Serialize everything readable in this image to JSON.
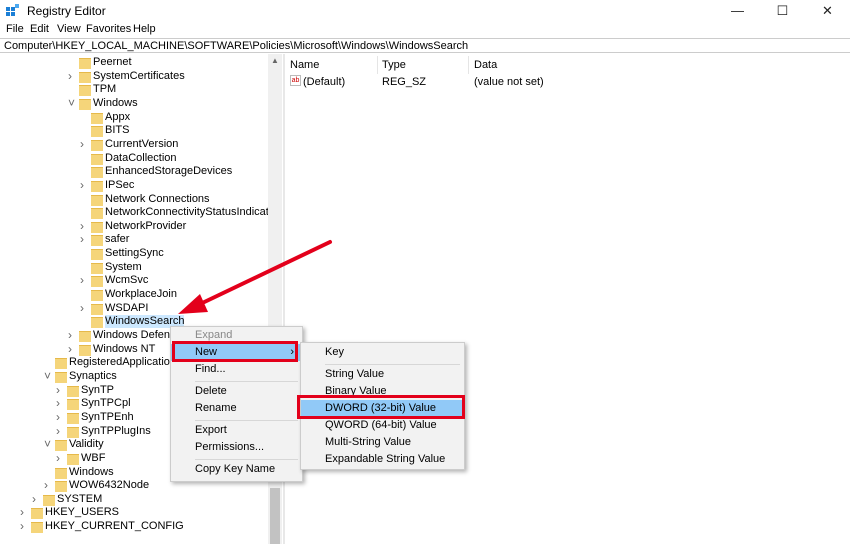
{
  "window": {
    "title": "Registry Editor",
    "controls": [
      "minimize",
      "maximize",
      "close"
    ]
  },
  "menubar": [
    "File",
    "Edit",
    "View",
    "Favorites",
    "Help"
  ],
  "address": "Computer\\HKEY_LOCAL_MACHINE\\SOFTWARE\\Policies\\Microsoft\\Windows\\WindowsSearch",
  "tree": [
    {
      "label": "Peernet",
      "level": 4,
      "exp": ""
    },
    {
      "label": "SystemCertificates",
      "level": 4,
      "exp": ">"
    },
    {
      "label": "TPM",
      "level": 4,
      "exp": ""
    },
    {
      "label": "Windows",
      "level": 4,
      "exp": "v"
    },
    {
      "label": "Appx",
      "level": 5,
      "exp": ""
    },
    {
      "label": "BITS",
      "level": 5,
      "exp": ""
    },
    {
      "label": "CurrentVersion",
      "level": 5,
      "exp": ">"
    },
    {
      "label": "DataCollection",
      "level": 5,
      "exp": ""
    },
    {
      "label": "EnhancedStorageDevices",
      "level": 5,
      "exp": ""
    },
    {
      "label": "IPSec",
      "level": 5,
      "exp": ">"
    },
    {
      "label": "Network Connections",
      "level": 5,
      "exp": ""
    },
    {
      "label": "NetworkConnectivityStatusIndicator",
      "level": 5,
      "exp": ""
    },
    {
      "label": "NetworkProvider",
      "level": 5,
      "exp": ">"
    },
    {
      "label": "safer",
      "level": 5,
      "exp": ">"
    },
    {
      "label": "SettingSync",
      "level": 5,
      "exp": ""
    },
    {
      "label": "System",
      "level": 5,
      "exp": ""
    },
    {
      "label": "WcmSvc",
      "level": 5,
      "exp": ">"
    },
    {
      "label": "WorkplaceJoin",
      "level": 5,
      "exp": ""
    },
    {
      "label": "WSDAPI",
      "level": 5,
      "exp": ">"
    },
    {
      "label": "WindowsSearch",
      "level": 5,
      "exp": "",
      "selected": true
    },
    {
      "label": "Windows Defender",
      "level": 4,
      "exp": ">"
    },
    {
      "label": "Windows NT",
      "level": 4,
      "exp": ">"
    },
    {
      "label": "RegisteredApplications",
      "level": 2,
      "exp": ""
    },
    {
      "label": "Synaptics",
      "level": 2,
      "exp": "v"
    },
    {
      "label": "SynTP",
      "level": 3,
      "exp": ">"
    },
    {
      "label": "SynTPCpl",
      "level": 3,
      "exp": ">"
    },
    {
      "label": "SynTPEnh",
      "level": 3,
      "exp": ">"
    },
    {
      "label": "SynTPPlugIns",
      "level": 3,
      "exp": ">"
    },
    {
      "label": "Validity",
      "level": 2,
      "exp": "v"
    },
    {
      "label": "WBF",
      "level": 3,
      "exp": ">"
    },
    {
      "label": "Windows",
      "level": 2,
      "exp": ""
    },
    {
      "label": "WOW6432Node",
      "level": 2,
      "exp": ">"
    },
    {
      "label": "SYSTEM",
      "level": 1,
      "exp": ">"
    },
    {
      "label": "HKEY_USERS",
      "level": 0,
      "exp": ">"
    },
    {
      "label": "HKEY_CURRENT_CONFIG",
      "level": 0,
      "exp": ">"
    }
  ],
  "values": {
    "columns": [
      "Name",
      "Type",
      "Data"
    ],
    "rows": [
      {
        "name": "(Default)",
        "type": "REG_SZ",
        "data": "(value not set)"
      }
    ]
  },
  "context_menu": {
    "items": [
      "Expand",
      "New",
      "Find...",
      "Delete",
      "Rename",
      "Export",
      "Permissions...",
      "Copy Key Name"
    ]
  },
  "submenu": {
    "items": [
      "Key",
      "String Value",
      "Binary Value",
      "DWORD (32-bit) Value",
      "QWORD (64-bit) Value",
      "Multi-String Value",
      "Expandable String Value"
    ]
  },
  "colors": {
    "highlight": "#91c9f7",
    "annotation_red": "#e3001b",
    "selection": "#cce8ff"
  }
}
